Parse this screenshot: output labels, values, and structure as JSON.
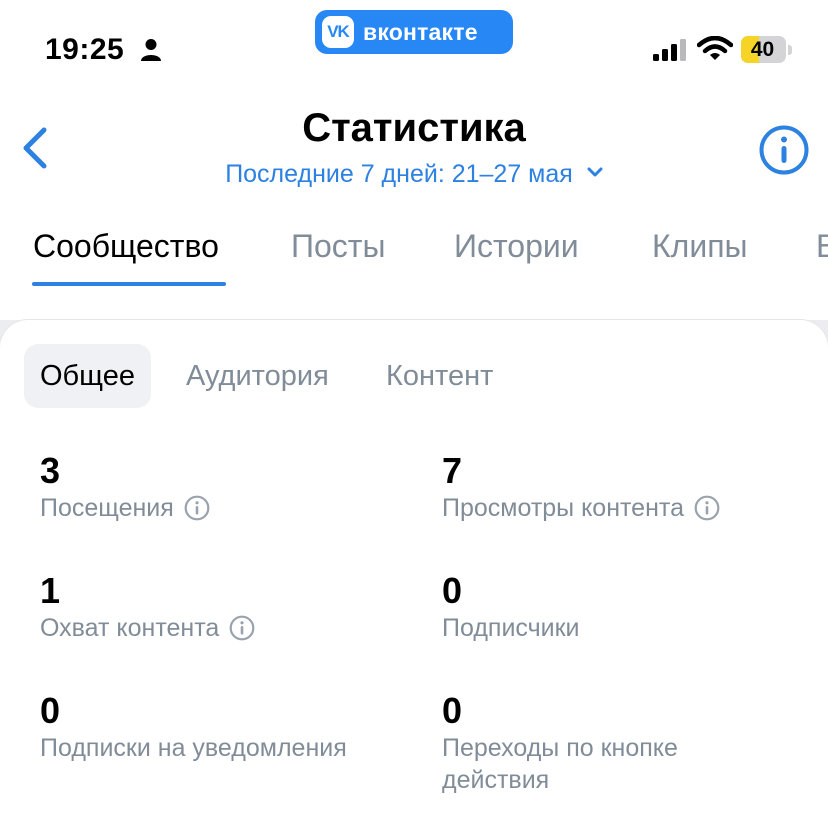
{
  "status_bar": {
    "time": "19:25",
    "battery_level": "40",
    "battery_fraction": 0.4
  },
  "app_badge": {
    "logo_text": "VK",
    "brand": "вконтакте",
    "brand_color": "#2787f5"
  },
  "header": {
    "title": "Статистика",
    "period": "Последние 7 дней: 21–27 мая",
    "accent_color": "#2d81e0"
  },
  "tabs": [
    {
      "label": "Сообщество",
      "active": true
    },
    {
      "label": "Посты",
      "active": false
    },
    {
      "label": "Истории",
      "active": false
    },
    {
      "label": "Клипы",
      "active": false
    },
    {
      "label": "В",
      "active": false
    }
  ],
  "segments": [
    {
      "label": "Общее",
      "active": true
    },
    {
      "label": "Аудитория",
      "active": false
    },
    {
      "label": "Контент",
      "active": false
    }
  ],
  "stats": [
    {
      "value": "3",
      "label": "Посещения",
      "info_icon": true
    },
    {
      "value": "7",
      "label": "Просмотры контента",
      "info_icon": true
    },
    {
      "value": "1",
      "label": "Охват контента",
      "info_icon": true
    },
    {
      "value": "0",
      "label": "Подписчики",
      "info_icon": false
    },
    {
      "value": "0",
      "label": "Подписки на уведомления",
      "info_icon": false
    },
    {
      "value": "0",
      "label": "Переходы по кнопке",
      "label_line2": "действия",
      "info_icon": false
    }
  ],
  "icons": [
    "person-icon",
    "signal-icon",
    "wifi-icon",
    "battery-icon",
    "back-arrow-icon",
    "chevron-down-icon",
    "info-icon"
  ]
}
